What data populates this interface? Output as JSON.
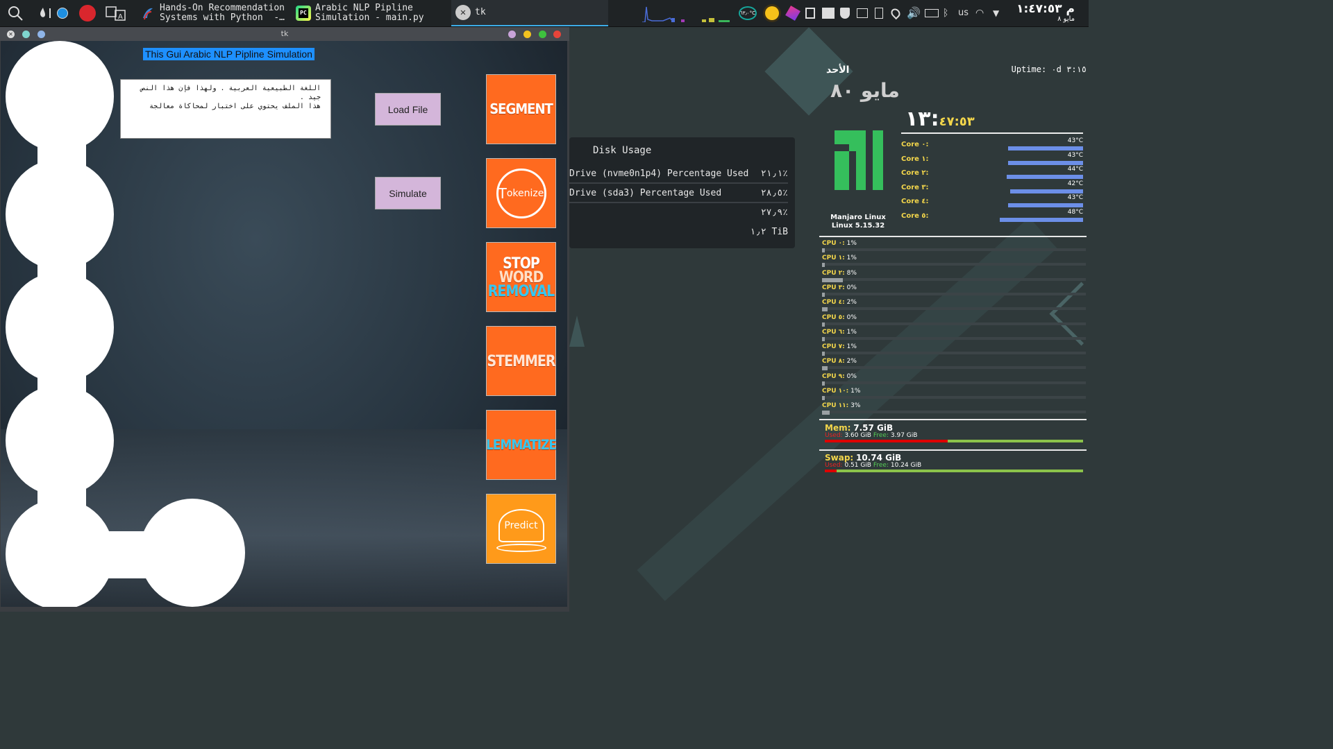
{
  "taskbar": {
    "tasks": [
      {
        "label": "Hands-On Recommendation\nSystems with Python  -…"
      },
      {
        "label": "Arabic NLP Pipline\nSimulation - main.py"
      },
      {
        "label": "tk"
      }
    ],
    "tray_temp": "٦٣٫٠°C",
    "keyboard_layout": "us",
    "clock_time": "م ١:٤٧:٥٣",
    "clock_date": "مايو ٨"
  },
  "window": {
    "title": "tk",
    "app_title": "This Gui Arabic NLP Pipline Simulation",
    "text_content": "اللغة الطبيعية العربية . ولهذا فإن هذا النص جيد .\nهذا الملف يحتوي على اختبار لمحاكاة معالجة",
    "load_button": "Load File",
    "simulate_button": "Simulate",
    "pipeline_buttons": {
      "segment": "SEGMENT",
      "tokenize": "okenize",
      "tokenize_prefix": "T",
      "stop_word_1": "STOP",
      "stop_word_2": "WORD",
      "stop_word_3": "REMOVAL",
      "stemmer": "STEMMER",
      "lemmatize": "LEMMATIZE",
      "predict": "Predict"
    }
  },
  "disk_widget": {
    "heading": "Disk Usage",
    "rows": [
      {
        "label": "Drive (nvme0n1p4) Percentage Used",
        "value": "٢١٫١٪",
        "fill": 0.211
      },
      {
        "label": "Drive (sda3) Percentage Used",
        "value": "٢٨٫٥٪",
        "fill": 0.285
      },
      {
        "label": "",
        "value": "٢٧٫٩٪",
        "fill": 0.279
      },
      {
        "label": "",
        "value": "١٫٢ TiB",
        "fill": 0
      }
    ]
  },
  "conky": {
    "day": "الأحد",
    "date": "مايو ٨٠",
    "uptime": "Uptime: ٠d ٣:١٥",
    "time_big": "١٣:",
    "time_small": "٤٧:٥٣",
    "os_name": "Manjaro Linux",
    "kernel": "Linux 5.15.32",
    "cores": [
      {
        "label": "Core ٠:",
        "temp": "43°C",
        "fill": 0.43
      },
      {
        "label": "Core ١:",
        "temp": "43°C",
        "fill": 0.43
      },
      {
        "label": "Core ٢:",
        "temp": "44°C",
        "fill": 0.44
      },
      {
        "label": "Core ٣:",
        "temp": "42°C",
        "fill": 0.42
      },
      {
        "label": "Core ٤:",
        "temp": "43°C",
        "fill": 0.43
      },
      {
        "label": "Core ٥:",
        "temp": "48°C",
        "fill": 0.48
      }
    ],
    "cpus": [
      {
        "label": "CPU ٠:",
        "value": "1%",
        "fill": 0.01
      },
      {
        "label": "CPU ١:",
        "value": "1%",
        "fill": 0.01
      },
      {
        "label": "CPU ٢:",
        "value": "8%",
        "fill": 0.08
      },
      {
        "label": "CPU ٣:",
        "value": "0%",
        "fill": 0.0
      },
      {
        "label": "CPU ٤:",
        "value": "2%",
        "fill": 0.02
      },
      {
        "label": "CPU ٥:",
        "value": "0%",
        "fill": 0.0
      },
      {
        "label": "CPU ٦:",
        "value": "1%",
        "fill": 0.01
      },
      {
        "label": "CPU ٧:",
        "value": "1%",
        "fill": 0.01
      },
      {
        "label": "CPU ٨:",
        "value": "2%",
        "fill": 0.02
      },
      {
        "label": "CPU ٩:",
        "value": "0%",
        "fill": 0.0
      },
      {
        "label": "CPU ١٠:",
        "value": "1%",
        "fill": 0.01
      },
      {
        "label": "CPU ١١:",
        "value": "3%",
        "fill": 0.03
      }
    ],
    "mem": {
      "label": "Mem:",
      "total": "7.57 GiB",
      "used_label": "Used:",
      "used": "3.60 GiB",
      "free_label": "Free:",
      "free": "3.97 GiB",
      "used_fraction": 0.476
    },
    "swap": {
      "label": "Swap:",
      "total": "10.74 GiB",
      "used_label": "Used:",
      "used": "0.51 GiB",
      "free_label": "Free:",
      "free": "10.24 GiB",
      "used_fraction": 0.047
    }
  },
  "colors": {
    "accent": "#3daee9",
    "button_orange": "#ff6a1f",
    "button_lilac": "#d4b6da",
    "manjaro_green": "#35bf5c",
    "conky_yellow": "#f3d64b"
  }
}
